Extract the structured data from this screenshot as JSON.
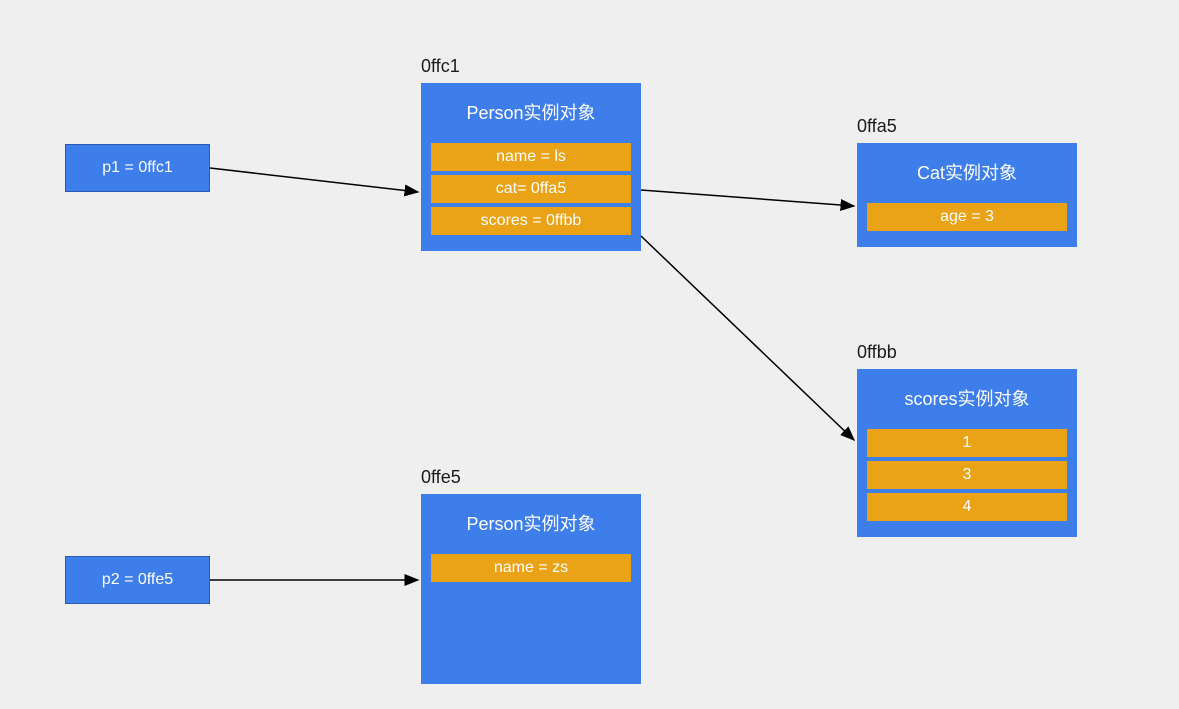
{
  "pointers": {
    "p1": "p1 = 0ffc1",
    "p2": "p2 = 0ffe5"
  },
  "objects": {
    "person1": {
      "addr": "0ffc1",
      "title": "Person实例对象",
      "fields": {
        "name": "name = ls",
        "cat": "cat= 0ffa5",
        "scores": "scores = 0ffbb"
      }
    },
    "person2": {
      "addr": "0ffe5",
      "title": "Person实例对象",
      "fields": {
        "name": "name = zs"
      }
    },
    "cat": {
      "addr": "0ffa5",
      "title": "Cat实例对象",
      "fields": {
        "age": "age = 3"
      }
    },
    "scores": {
      "addr": "0ffbb",
      "title": "scores实例对象",
      "values": [
        "1",
        "3",
        "4"
      ]
    }
  }
}
